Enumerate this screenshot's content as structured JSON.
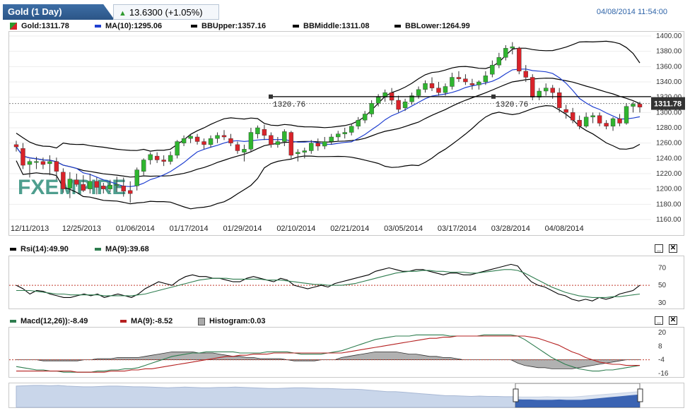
{
  "header": {
    "instrument": "Gold (1 Day)",
    "change": "13.6300 (+1.05%)",
    "datetime": "04/08/2014 11:54:00"
  },
  "main_legend": {
    "gold": "Gold:1311.78",
    "ma": "MA(10):1295.06",
    "bb_upper": "BBUpper:1357.16",
    "bb_middle": "BBMiddle:1311.08",
    "bb_lower": "BBLower:1264.99"
  },
  "rsi_legend": {
    "rsi": "Rsi(14):49.90",
    "ma": "MA(9):39.68"
  },
  "macd_legend": {
    "macd": "Macd(12,26)):-8.49",
    "ma": "MA(9):-8.52",
    "histogram": "Histogram:0.03"
  },
  "main_panel": {
    "last_price_label": "1311.78",
    "hline_labels": [
      "1320.76",
      "1320.76"
    ],
    "watermark": "FXEMPIRE"
  },
  "colors": {
    "up": "#2fb52f",
    "down": "#d9232a",
    "ma": "#1f3fd0",
    "bands": "#000000",
    "rsi": "#000000",
    "rsi_ma": "#2e7d4f",
    "macd": "#2e7d4f",
    "macd_ma": "#b52020",
    "histogram": "#a9a9a9",
    "header_tab": "#2f5f96"
  },
  "chart_data": [
    {
      "id": "price",
      "type": "candlestick",
      "title": "Gold (1 Day)",
      "x_tick_labels": [
        "12/11/2013",
        "12/25/2013",
        "01/06/2014",
        "01/17/2014",
        "01/29/2014",
        "02/10/2014",
        "02/21/2014",
        "03/05/2014",
        "03/17/2014",
        "03/28/2014",
        "04/08/2014"
      ],
      "x_tick_index": [
        0,
        10,
        18,
        26,
        34,
        42,
        50,
        58,
        66,
        74,
        82
      ],
      "ylim": [
        1160,
        1400
      ],
      "y_ticks": [
        1160,
        1180,
        1200,
        1220,
        1240,
        1260,
        1280,
        1300,
        1320,
        1340,
        1360,
        1380,
        1400
      ],
      "horizontal_line": 1320.76,
      "candles": [
        [
          1258,
          1263,
          1249,
          1255
        ],
        [
          1253,
          1260,
          1226,
          1231
        ],
        [
          1232,
          1239,
          1215,
          1236
        ],
        [
          1235,
          1242,
          1226,
          1236
        ],
        [
          1236,
          1241,
          1226,
          1232
        ],
        [
          1233,
          1244,
          1218,
          1236
        ],
        [
          1236,
          1241,
          1212,
          1223
        ],
        [
          1222,
          1227,
          1195,
          1200
        ],
        [
          1201,
          1222,
          1188,
          1213
        ],
        [
          1212,
          1220,
          1203,
          1206
        ],
        [
          1206,
          1218,
          1196,
          1198
        ],
        [
          1200,
          1220,
          1194,
          1210
        ],
        [
          1210,
          1215,
          1193,
          1202
        ],
        [
          1204,
          1208,
          1194,
          1200
        ],
        [
          1200,
          1212,
          1196,
          1205
        ],
        [
          1205,
          1216,
          1196,
          1206
        ],
        [
          1204,
          1215,
          1190,
          1197
        ],
        [
          1198,
          1210,
          1182,
          1194
        ],
        [
          1204,
          1228,
          1198,
          1225
        ],
        [
          1223,
          1240,
          1218,
          1238
        ],
        [
          1238,
          1248,
          1232,
          1245
        ],
        [
          1243,
          1248,
          1234,
          1238
        ],
        [
          1238,
          1244,
          1230,
          1236
        ],
        [
          1236,
          1249,
          1232,
          1244
        ],
        [
          1244,
          1264,
          1240,
          1262
        ],
        [
          1260,
          1270,
          1256,
          1266
        ],
        [
          1266,
          1272,
          1260,
          1269
        ],
        [
          1268,
          1272,
          1258,
          1262
        ],
        [
          1262,
          1266,
          1252,
          1258
        ],
        [
          1258,
          1270,
          1254,
          1266
        ],
        [
          1266,
          1274,
          1260,
          1270
        ],
        [
          1270,
          1277,
          1264,
          1268
        ],
        [
          1266,
          1272,
          1256,
          1260
        ],
        [
          1258,
          1262,
          1246,
          1250
        ],
        [
          1248,
          1258,
          1236,
          1252
        ],
        [
          1252,
          1280,
          1248,
          1274
        ],
        [
          1272,
          1283,
          1266,
          1280
        ],
        [
          1278,
          1284,
          1264,
          1270
        ],
        [
          1270,
          1274,
          1254,
          1258
        ],
        [
          1258,
          1268,
          1254,
          1262
        ],
        [
          1262,
          1278,
          1256,
          1275
        ],
        [
          1274,
          1276,
          1240,
          1244
        ],
        [
          1246,
          1252,
          1236,
          1248
        ],
        [
          1248,
          1254,
          1240,
          1250
        ],
        [
          1250,
          1264,
          1246,
          1260
        ],
        [
          1260,
          1266,
          1250,
          1256
        ],
        [
          1256,
          1268,
          1252,
          1262
        ],
        [
          1262,
          1272,
          1258,
          1268
        ],
        [
          1268,
          1276,
          1262,
          1272
        ],
        [
          1272,
          1280,
          1266,
          1274
        ],
        [
          1274,
          1285,
          1270,
          1282
        ],
        [
          1282,
          1294,
          1278,
          1290
        ],
        [
          1290,
          1302,
          1286,
          1298
        ],
        [
          1298,
          1316,
          1294,
          1312
        ],
        [
          1312,
          1324,
          1308,
          1320
        ],
        [
          1320,
          1330,
          1314,
          1326
        ],
        [
          1326,
          1332,
          1310,
          1316
        ],
        [
          1316,
          1322,
          1300,
          1304
        ],
        [
          1306,
          1318,
          1302,
          1314
        ],
        [
          1314,
          1326,
          1310,
          1322
        ],
        [
          1322,
          1334,
          1318,
          1330
        ],
        [
          1330,
          1342,
          1326,
          1338
        ],
        [
          1338,
          1346,
          1328,
          1332
        ],
        [
          1332,
          1340,
          1322,
          1326
        ],
        [
          1326,
          1338,
          1322,
          1334
        ],
        [
          1334,
          1352,
          1330,
          1346
        ],
        [
          1346,
          1354,
          1340,
          1344
        ],
        [
          1344,
          1350,
          1336,
          1340
        ],
        [
          1338,
          1344,
          1330,
          1336
        ],
        [
          1336,
          1342,
          1330,
          1340
        ],
        [
          1340,
          1354,
          1336,
          1348
        ],
        [
          1350,
          1368,
          1346,
          1362
        ],
        [
          1362,
          1378,
          1358,
          1372
        ],
        [
          1372,
          1388,
          1368,
          1384
        ],
        [
          1384,
          1392,
          1376,
          1386
        ],
        [
          1384,
          1386,
          1350,
          1354
        ],
        [
          1354,
          1362,
          1340,
          1346
        ],
        [
          1346,
          1350,
          1316,
          1320
        ],
        [
          1320,
          1332,
          1316,
          1328
        ],
        [
          1328,
          1338,
          1322,
          1332
        ],
        [
          1332,
          1336,
          1318,
          1326
        ],
        [
          1326,
          1332,
          1300,
          1306
        ],
        [
          1304,
          1310,
          1292,
          1300
        ],
        [
          1300,
          1306,
          1286,
          1290
        ],
        [
          1290,
          1296,
          1278,
          1282
        ],
        [
          1282,
          1300,
          1280,
          1294
        ],
        [
          1294,
          1300,
          1286,
          1296
        ],
        [
          1296,
          1300,
          1282,
          1286
        ],
        [
          1286,
          1290,
          1278,
          1282
        ],
        [
          1282,
          1294,
          1276,
          1292
        ],
        [
          1292,
          1298,
          1282,
          1286
        ],
        [
          1286,
          1312,
          1284,
          1308
        ],
        [
          1308,
          1314,
          1300,
          1311
        ],
        [
          1311,
          1314,
          1300,
          1307
        ]
      ]
    },
    {
      "id": "rsi",
      "type": "line",
      "ylim": [
        25,
        80
      ],
      "y_ticks": [
        30,
        50,
        70
      ],
      "reference_line": 50,
      "series": [
        {
          "name": "Rsi(14)",
          "values": [
            50,
            46,
            40,
            44,
            43,
            40,
            38,
            36,
            36,
            38,
            40,
            38,
            40,
            36,
            38,
            40,
            38,
            36,
            40,
            46,
            50,
            54,
            52,
            50,
            56,
            60,
            62,
            60,
            60,
            58,
            58,
            56,
            54,
            54,
            58,
            60,
            58,
            56,
            54,
            58,
            56,
            50,
            48,
            46,
            48,
            50,
            48,
            52,
            54,
            56,
            58,
            60,
            62,
            66,
            68,
            70,
            68,
            66,
            66,
            68,
            68,
            66,
            64,
            62,
            64,
            64,
            62,
            62,
            64,
            66,
            68,
            70,
            72,
            74,
            72,
            62,
            54,
            50,
            48,
            44,
            40,
            38,
            34,
            32,
            34,
            32,
            36,
            34,
            36,
            40,
            42,
            44,
            50
          ]
        },
        {
          "name": "MA(9)",
          "values": [
            44,
            44,
            44,
            43,
            42,
            41,
            40,
            40,
            39,
            39,
            39,
            39,
            39,
            38,
            38,
            38,
            38,
            38,
            39,
            40,
            42,
            44,
            46,
            48,
            50,
            52,
            54,
            56,
            57,
            58,
            58,
            58,
            57,
            57,
            57,
            57,
            57,
            56,
            56,
            56,
            55,
            54,
            53,
            52,
            51,
            51,
            50,
            50,
            50,
            51,
            52,
            54,
            56,
            58,
            60,
            62,
            64,
            65,
            66,
            66,
            67,
            67,
            66,
            66,
            65,
            65,
            65,
            64,
            64,
            65,
            66,
            67,
            68,
            68,
            67,
            64,
            60,
            56,
            52,
            48,
            45,
            42,
            40,
            38,
            37,
            36,
            36,
            36,
            37,
            37,
            38,
            39,
            40
          ]
        }
      ]
    },
    {
      "id": "macd",
      "type": "line",
      "ylim": [
        -18,
        22
      ],
      "y_ticks": [
        -16,
        -4,
        8,
        20
      ],
      "reference_line": -4,
      "series": [
        {
          "name": "Macd(12,26))",
          "values": [
            -10,
            -11,
            -12,
            -13,
            -13,
            -14,
            -14,
            -15,
            -15,
            -15,
            -15,
            -15,
            -14,
            -14,
            -13,
            -13,
            -12,
            -12,
            -11,
            -9,
            -7,
            -5,
            -3,
            -1,
            0,
            1,
            2,
            2,
            3,
            3,
            3,
            3,
            3,
            2,
            2,
            2,
            2,
            3,
            3,
            3,
            3,
            2,
            1,
            1,
            1,
            1,
            2,
            3,
            4,
            6,
            8,
            10,
            12,
            14,
            15,
            16,
            17,
            17,
            17,
            18,
            18,
            18,
            18,
            18,
            17,
            17,
            17,
            17,
            17,
            18,
            18,
            18,
            18,
            18,
            17,
            14,
            10,
            6,
            2,
            -2,
            -5,
            -8,
            -10,
            -12,
            -13,
            -14,
            -14,
            -13,
            -13,
            -12,
            -11,
            -10,
            -9
          ]
        },
        {
          "name": "MA(9)",
          "values": [
            -14,
            -14,
            -14,
            -14,
            -14,
            -14,
            -14,
            -14,
            -14,
            -15,
            -15,
            -15,
            -15,
            -15,
            -14,
            -14,
            -14,
            -13,
            -13,
            -12,
            -12,
            -11,
            -10,
            -9,
            -8,
            -7,
            -6,
            -5,
            -4,
            -3,
            -2,
            -1,
            -1,
            0,
            0,
            1,
            1,
            1,
            2,
            2,
            2,
            2,
            2,
            2,
            2,
            2,
            2,
            2,
            2,
            3,
            4,
            5,
            6,
            7,
            8,
            9,
            10,
            11,
            12,
            13,
            14,
            15,
            15,
            16,
            16,
            17,
            17,
            17,
            17,
            17,
            17,
            17,
            17,
            17,
            17,
            17,
            16,
            15,
            13,
            11,
            9,
            6,
            3,
            1,
            -2,
            -4,
            -6,
            -7,
            -8,
            -8,
            -9,
            -9,
            -9
          ]
        }
      ],
      "histogram": [
        0,
        0,
        0,
        0,
        -1,
        -1,
        -1,
        -1,
        -1,
        -1,
        0,
        0,
        1,
        1,
        1,
        2,
        2,
        2,
        2,
        3,
        4,
        5,
        6,
        7,
        7,
        7,
        7,
        6,
        6,
        6,
        5,
        4,
        3,
        3,
        2,
        2,
        1,
        1,
        1,
        1,
        0,
        -1,
        -1,
        -1,
        -1,
        0,
        0,
        0,
        2,
        3,
        4,
        5,
        6,
        7,
        7,
        7,
        7,
        6,
        5,
        5,
        4,
        3,
        3,
        2,
        2,
        1,
        0,
        0,
        0,
        0,
        0,
        0,
        0,
        0,
        -3,
        -5,
        -6,
        -7,
        -7,
        -8,
        -8,
        -8,
        -8,
        -7,
        -6,
        -5,
        -4,
        -3,
        -2,
        -1,
        0,
        0,
        0
      ]
    },
    {
      "id": "navigator",
      "type": "area",
      "values": [
        62,
        63,
        64,
        64,
        63,
        64,
        62,
        61,
        60,
        60,
        61,
        62,
        62,
        61,
        60,
        60,
        59,
        58,
        57,
        58,
        59,
        58,
        57,
        57,
        58,
        58,
        59,
        58,
        57,
        56,
        55,
        55,
        56,
        57,
        57,
        56,
        55,
        55,
        54,
        53,
        53,
        52,
        50,
        48,
        46,
        46,
        44,
        42,
        40,
        38,
        36,
        34,
        34,
        33,
        32,
        33,
        32,
        32,
        31,
        31,
        30,
        30,
        30,
        31,
        30,
        30,
        30,
        32,
        34,
        36,
        38,
        40,
        42,
        44,
        46
      ]
    }
  ]
}
